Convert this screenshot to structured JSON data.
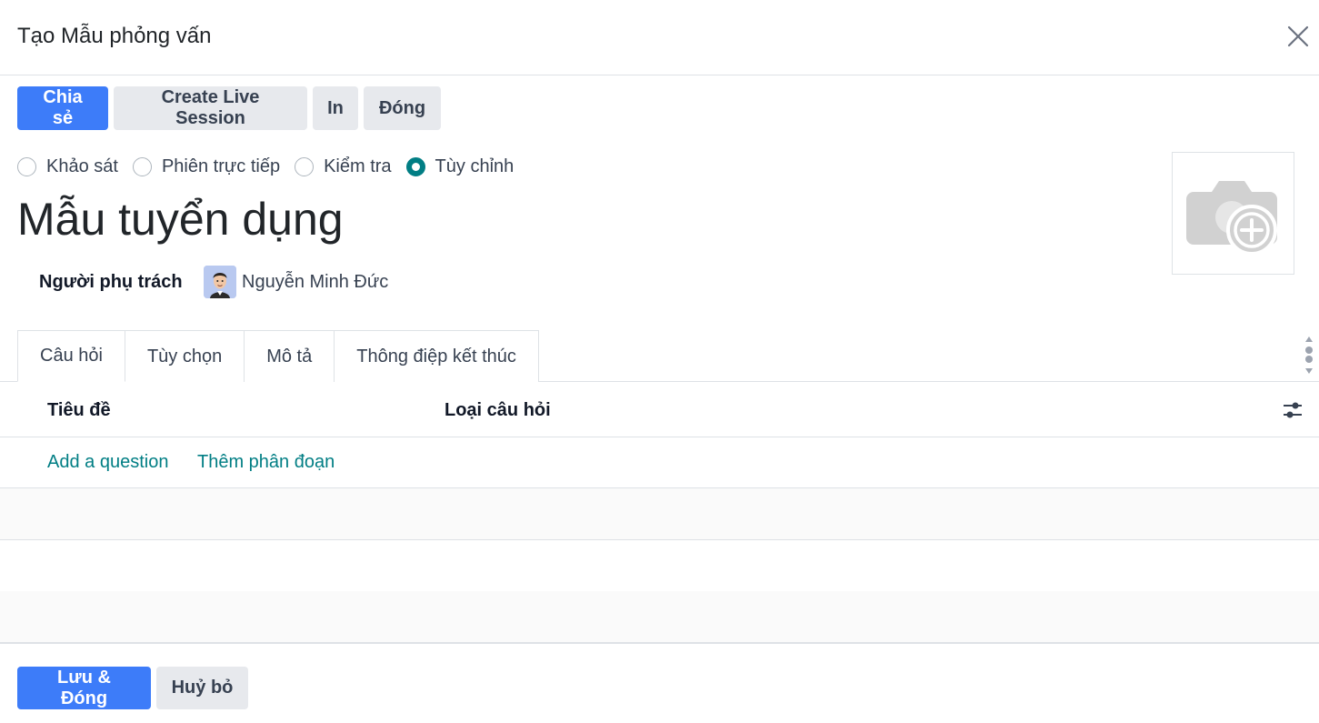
{
  "dialog": {
    "title": "Tạo Mẫu phỏng vấn"
  },
  "toolbar": {
    "share_label": "Chia sẻ",
    "live_session_label": "Create Live Session",
    "print_label": "In",
    "close_label": "Đóng"
  },
  "survey_type": {
    "options": [
      {
        "label": "Khảo sát",
        "checked": false
      },
      {
        "label": "Phiên trực tiếp",
        "checked": false
      },
      {
        "label": "Kiểm tra",
        "checked": false
      },
      {
        "label": "Tùy chỉnh",
        "checked": true
      }
    ]
  },
  "form": {
    "title": "Mẫu tuyển dụng",
    "owner_label": "Người phụ trách",
    "owner_name": "Nguyễn Minh Đức"
  },
  "tabs": [
    {
      "label": "Câu hỏi",
      "active": true
    },
    {
      "label": "Tùy chọn",
      "active": false
    },
    {
      "label": "Mô tả",
      "active": false
    },
    {
      "label": "Thông điệp kết thúc",
      "active": false
    }
  ],
  "table": {
    "columns": [
      "Tiêu đề",
      "Loại câu hỏi"
    ],
    "add_question_label": "Add a question",
    "add_section_label": "Thêm phân đoạn"
  },
  "footer": {
    "save_label": "Lưu & Đóng",
    "cancel_label": "Huỷ bỏ"
  },
  "colors": {
    "primary": "#3d7cf9",
    "accent": "#017e84",
    "secondary_bg": "#e7e9ed"
  },
  "icons": {
    "close": "close-icon",
    "camera": "camera-plus-icon",
    "settings": "sliders-icon",
    "scroll": "scroll-handle-icon"
  }
}
